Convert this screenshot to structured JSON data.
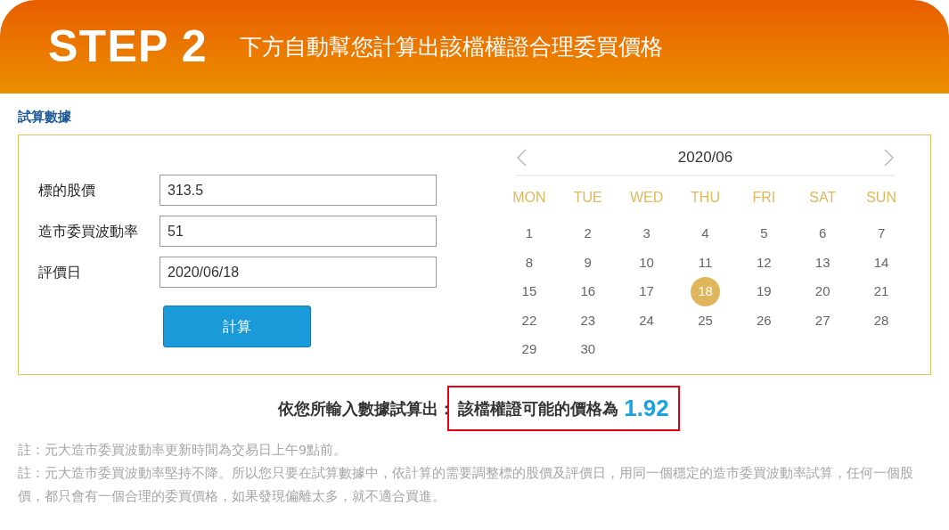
{
  "header": {
    "step": "STEP 2",
    "title": "下方自動幫您計算出該檔權證合理委買價格"
  },
  "section_label": "試算數據",
  "form": {
    "fields": [
      {
        "label": "標的股價",
        "value": "313.5"
      },
      {
        "label": "造市委買波動率",
        "value": "51"
      },
      {
        "label": "評價日",
        "value": "2020/06/18"
      }
    ],
    "button": "計算"
  },
  "calendar": {
    "month": "2020/06",
    "weekdays": [
      "MON",
      "TUE",
      "WED",
      "THU",
      "FRI",
      "SAT",
      "SUN"
    ],
    "days": [
      {
        "label": "1",
        "selected": false
      },
      {
        "label": "2",
        "selected": false
      },
      {
        "label": "3",
        "selected": false
      },
      {
        "label": "4",
        "selected": false
      },
      {
        "label": "5",
        "selected": false
      },
      {
        "label": "6",
        "selected": false
      },
      {
        "label": "7",
        "selected": false
      },
      {
        "label": "8",
        "selected": false
      },
      {
        "label": "9",
        "selected": false
      },
      {
        "label": "10",
        "selected": false
      },
      {
        "label": "11",
        "selected": false
      },
      {
        "label": "12",
        "selected": false
      },
      {
        "label": "13",
        "selected": false
      },
      {
        "label": "14",
        "selected": false
      },
      {
        "label": "15",
        "selected": false
      },
      {
        "label": "16",
        "selected": false
      },
      {
        "label": "17",
        "selected": false
      },
      {
        "label": "18",
        "selected": true
      },
      {
        "label": "19",
        "selected": false
      },
      {
        "label": "20",
        "selected": false
      },
      {
        "label": "21",
        "selected": false
      },
      {
        "label": "22",
        "selected": false
      },
      {
        "label": "23",
        "selected": false
      },
      {
        "label": "24",
        "selected": false
      },
      {
        "label": "25",
        "selected": false
      },
      {
        "label": "26",
        "selected": false
      },
      {
        "label": "27",
        "selected": false
      },
      {
        "label": "28",
        "selected": false
      },
      {
        "label": "29",
        "selected": false
      },
      {
        "label": "30",
        "selected": false
      }
    ]
  },
  "result": {
    "prefix": "依您所輸入數據試算出：",
    "label": "該檔權證可能的價格為",
    "value": "1.92"
  },
  "notes": [
    "註：元大造市委買波動率更新時間為交易日上午9點前。",
    "註：元大造市委買波動率堅持不降。所以您只要在試算數據中，依計算的需要調整標的股價及評價日，用同一個穩定的造市委買波動率試算，任何一個股價，都只會有一個合理的委買價格，如果發現偏離太多，就不適合買進。"
  ]
}
